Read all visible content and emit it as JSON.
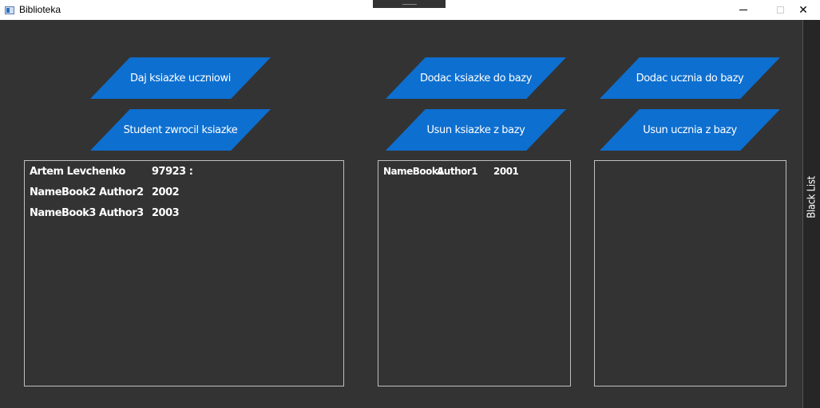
{
  "window": {
    "title": "Biblioteka",
    "controls": {
      "minimize": "—",
      "maximize": "□",
      "close": "✕"
    }
  },
  "buttons": {
    "give_book": "Daj ksiazke uczniowi",
    "return_book": "Student zwrocil ksiazke",
    "add_book": "Dodac ksiazke do bazy",
    "remove_book": "Usun ksiazke z bazy",
    "add_student": "Dodac ucznia do bazy",
    "remove_student": "Usun ucznia z bazy"
  },
  "student_list": {
    "header": {
      "name": "Artem Levchenko",
      "id": "97923 :"
    },
    "rows": [
      {
        "book": "NameBook2 Author2",
        "year": "2002"
      },
      {
        "book": "NameBook3 Author3",
        "year": "2003"
      }
    ]
  },
  "book_list": {
    "rows": [
      {
        "name": "NameBook1",
        "author": "Author1",
        "year": "2001"
      }
    ]
  },
  "student_list_2": {
    "rows": []
  },
  "sidebar": {
    "label": "Black List"
  },
  "colors": {
    "background": "#333333",
    "button": "#0d6fd0",
    "text": "#ffffff",
    "border": "#bfbfbf"
  }
}
